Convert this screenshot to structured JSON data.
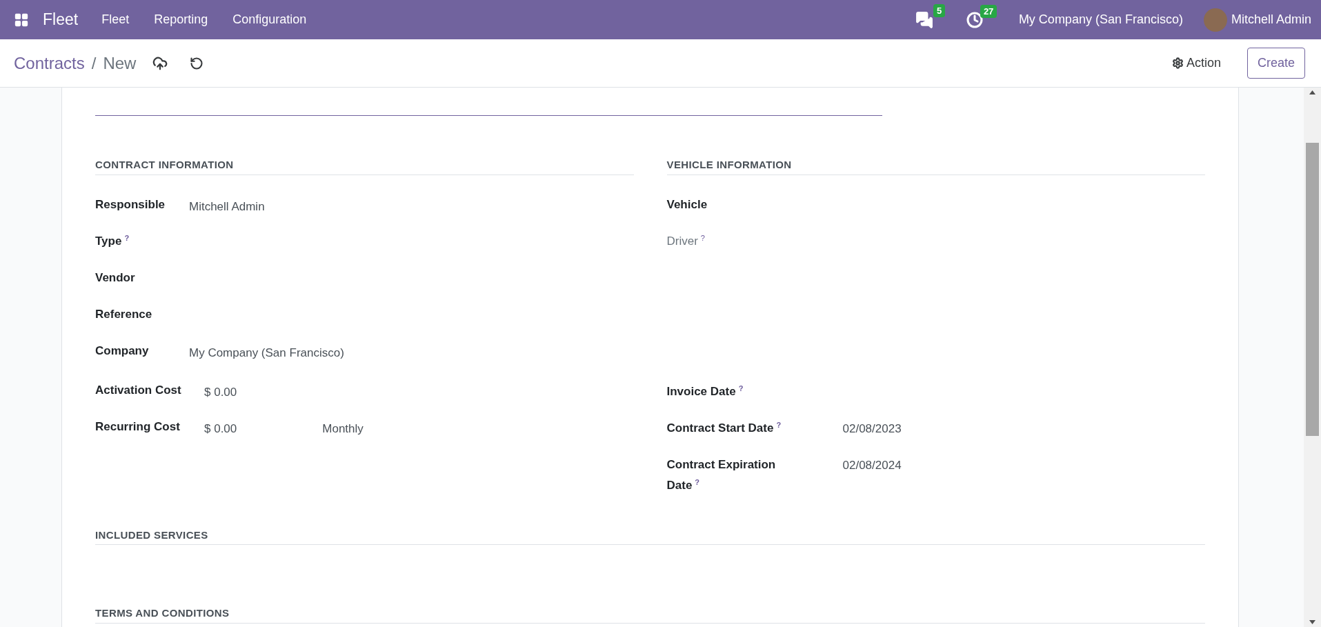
{
  "navbar": {
    "app_name": "Fleet",
    "menus": [
      "Fleet",
      "Reporting",
      "Configuration"
    ],
    "messages_count": "5",
    "activities_count": "27",
    "company": "My Company (San Francisco)",
    "user": "Mitchell Admin"
  },
  "breadcrumb": {
    "parent": "Contracts",
    "separator": "/",
    "current": "New"
  },
  "actions": {
    "action": "Action",
    "create": "Create"
  },
  "sections": [
    {
      "title": "CONTRACT INFORMATION"
    },
    {
      "title": "VEHICLE INFORMATION"
    }
  ],
  "top_left_fields": [
    {
      "label": "Responsible",
      "value": "Mitchell Admin",
      "disabled": false
    },
    {
      "label": "Type",
      "help": "?",
      "disabled": false
    },
    {
      "label": "Vendor",
      "disabled": false
    },
    {
      "label": "Reference",
      "disabled": false
    },
    {
      "label": "Company",
      "value": "My Company (San Francisco)",
      "disabled": false
    }
  ],
  "top_right_fields": [
    {
      "label": "Vehicle",
      "disabled": false
    },
    {
      "label": "Driver",
      "help": "?",
      "disabled": true
    }
  ],
  "bottom_left_fields": [
    {
      "label": "Activation Cost",
      "value": "$ 0.00"
    },
    {
      "label": "Recurring Cost",
      "value": "$ 0.00",
      "extra": "Monthly"
    }
  ],
  "bottom_right_fields": [
    {
      "label": "Invoice Date",
      "help": "?"
    },
    {
      "label": "Contract Start Date",
      "help": "?",
      "value": "02/08/2023"
    },
    {
      "label": "Contract Expiration Date",
      "help": "?",
      "value": "02/08/2024"
    }
  ],
  "lower_sections": [
    {
      "title": "INCLUDED SERVICES"
    },
    {
      "title": "TERMS AND CONDITIONS"
    }
  ]
}
